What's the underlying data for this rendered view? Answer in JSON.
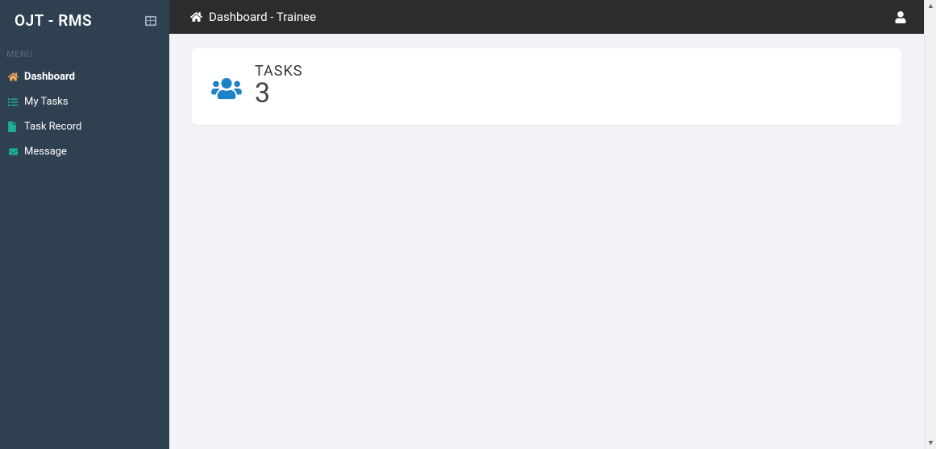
{
  "brand": {
    "title": "OJT - RMS"
  },
  "sidebar": {
    "menu_heading": "MENU",
    "items": [
      {
        "label": "Dashboard"
      },
      {
        "label": "My Tasks"
      },
      {
        "label": "Task Record"
      },
      {
        "label": "Message"
      }
    ]
  },
  "topbar": {
    "title": "Dashboard - Trainee"
  },
  "card": {
    "title": "TASKS",
    "value": "3"
  }
}
